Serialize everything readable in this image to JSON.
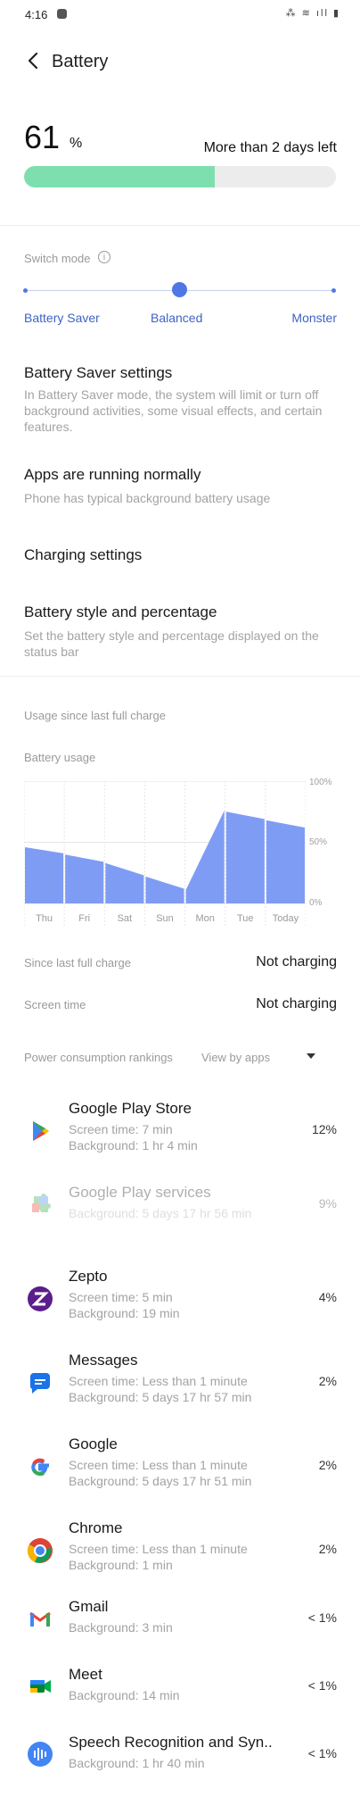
{
  "status_bar": {
    "time": "4:16",
    "icons": "⁂ ≋ ıll ▮"
  },
  "header": {
    "title": "Battery"
  },
  "battery": {
    "percent": "61",
    "percent_sign": "%",
    "time_left": "More than 2 days left",
    "level_fraction": 0.61,
    "fill_color": "#7ddfad"
  },
  "mode": {
    "label": "Switch mode",
    "options": [
      "Battery Saver",
      "Balanced",
      "Monster"
    ],
    "selected": "Balanced",
    "accent": "#4f78e6"
  },
  "settings": [
    {
      "title": "Battery Saver settings",
      "desc": "In Battery Saver mode, the system will limit or turn off background activities, some visual effects, and certain features."
    },
    {
      "title": "Apps are running normally",
      "desc": "Phone has typical background battery usage"
    },
    {
      "title": "Charging settings",
      "desc": ""
    },
    {
      "title": "Battery style and percentage",
      "desc": "Set the battery style and percentage displayed on the status bar"
    }
  ],
  "usage": {
    "since_label": "Usage since last full charge",
    "chart_label": "Battery usage"
  },
  "chart_data": {
    "type": "area",
    "categories": [
      "Thu",
      "Fri",
      "Sat",
      "Sun",
      "Mon",
      "Tue",
      "Today"
    ],
    "y_ticks": [
      "100%",
      "50%",
      "0%"
    ],
    "ylim": [
      0,
      100
    ],
    "segments": [
      {
        "category": "Thu",
        "start": 46,
        "end": 41
      },
      {
        "category": "Fri",
        "start": 40,
        "end": 34
      },
      {
        "category": "Sat",
        "start": 33,
        "end": 23
      },
      {
        "category": "Sun",
        "start": 22,
        "end": 12
      },
      {
        "category": "Mon",
        "start": 11,
        "end": 76
      },
      {
        "category": "Tue",
        "start": 75,
        "end": 69
      },
      {
        "category": "Today",
        "start": 68,
        "end": 62
      }
    ],
    "color": "#7f9cf5",
    "grid": true
  },
  "info_rows": [
    {
      "label": "Since last full charge",
      "value": "Not charging"
    },
    {
      "label": "Screen time",
      "value": "Not charging"
    }
  ],
  "rankings": {
    "label": "Power consumption rankings",
    "select": "View by apps"
  },
  "apps": [
    {
      "name": "Google Play Store",
      "line1": "Screen time: 7 min",
      "line2": "Background: 1 hr 4 min",
      "pct": "12%",
      "icon": "play-store-icon",
      "faded": false
    },
    {
      "name": "Google Play services",
      "line1": "Background: 5 days 17 hr 56 min",
      "line2": "",
      "pct": "9%",
      "icon": "play-services-icon",
      "faded": true
    },
    {
      "name": "Zepto",
      "line1": "Screen time: 5 min",
      "line2": "Background: 19 min",
      "pct": "4%",
      "icon": "zepto-icon",
      "faded": false
    },
    {
      "name": "Messages",
      "line1": "Screen time: Less than 1 minute",
      "line2": "Background: 5 days 17 hr 57 min",
      "pct": "2%",
      "icon": "messages-icon",
      "faded": false
    },
    {
      "name": "Google",
      "line1": "Screen time: Less than 1 minute",
      "line2": "Background: 5 days 17 hr 51 min",
      "pct": "2%",
      "icon": "google-icon",
      "faded": false
    },
    {
      "name": "Chrome",
      "line1": "Screen time: Less than 1 minute",
      "line2": "Background: 1 min",
      "pct": "2%",
      "icon": "chrome-icon",
      "faded": false
    },
    {
      "name": "Gmail",
      "line1": "Background: 3 min",
      "line2": "",
      "pct": "< 1%",
      "icon": "gmail-icon",
      "faded": false
    },
    {
      "name": "Meet",
      "line1": "Background: 14 min",
      "line2": "",
      "pct": "< 1%",
      "icon": "meet-icon",
      "faded": false
    },
    {
      "name": "Speech Recognition and Syn..",
      "line1": "Background: 1 hr 40 min",
      "line2": "",
      "pct": "< 1%",
      "icon": "speech-recognition-icon",
      "faded": false
    }
  ]
}
